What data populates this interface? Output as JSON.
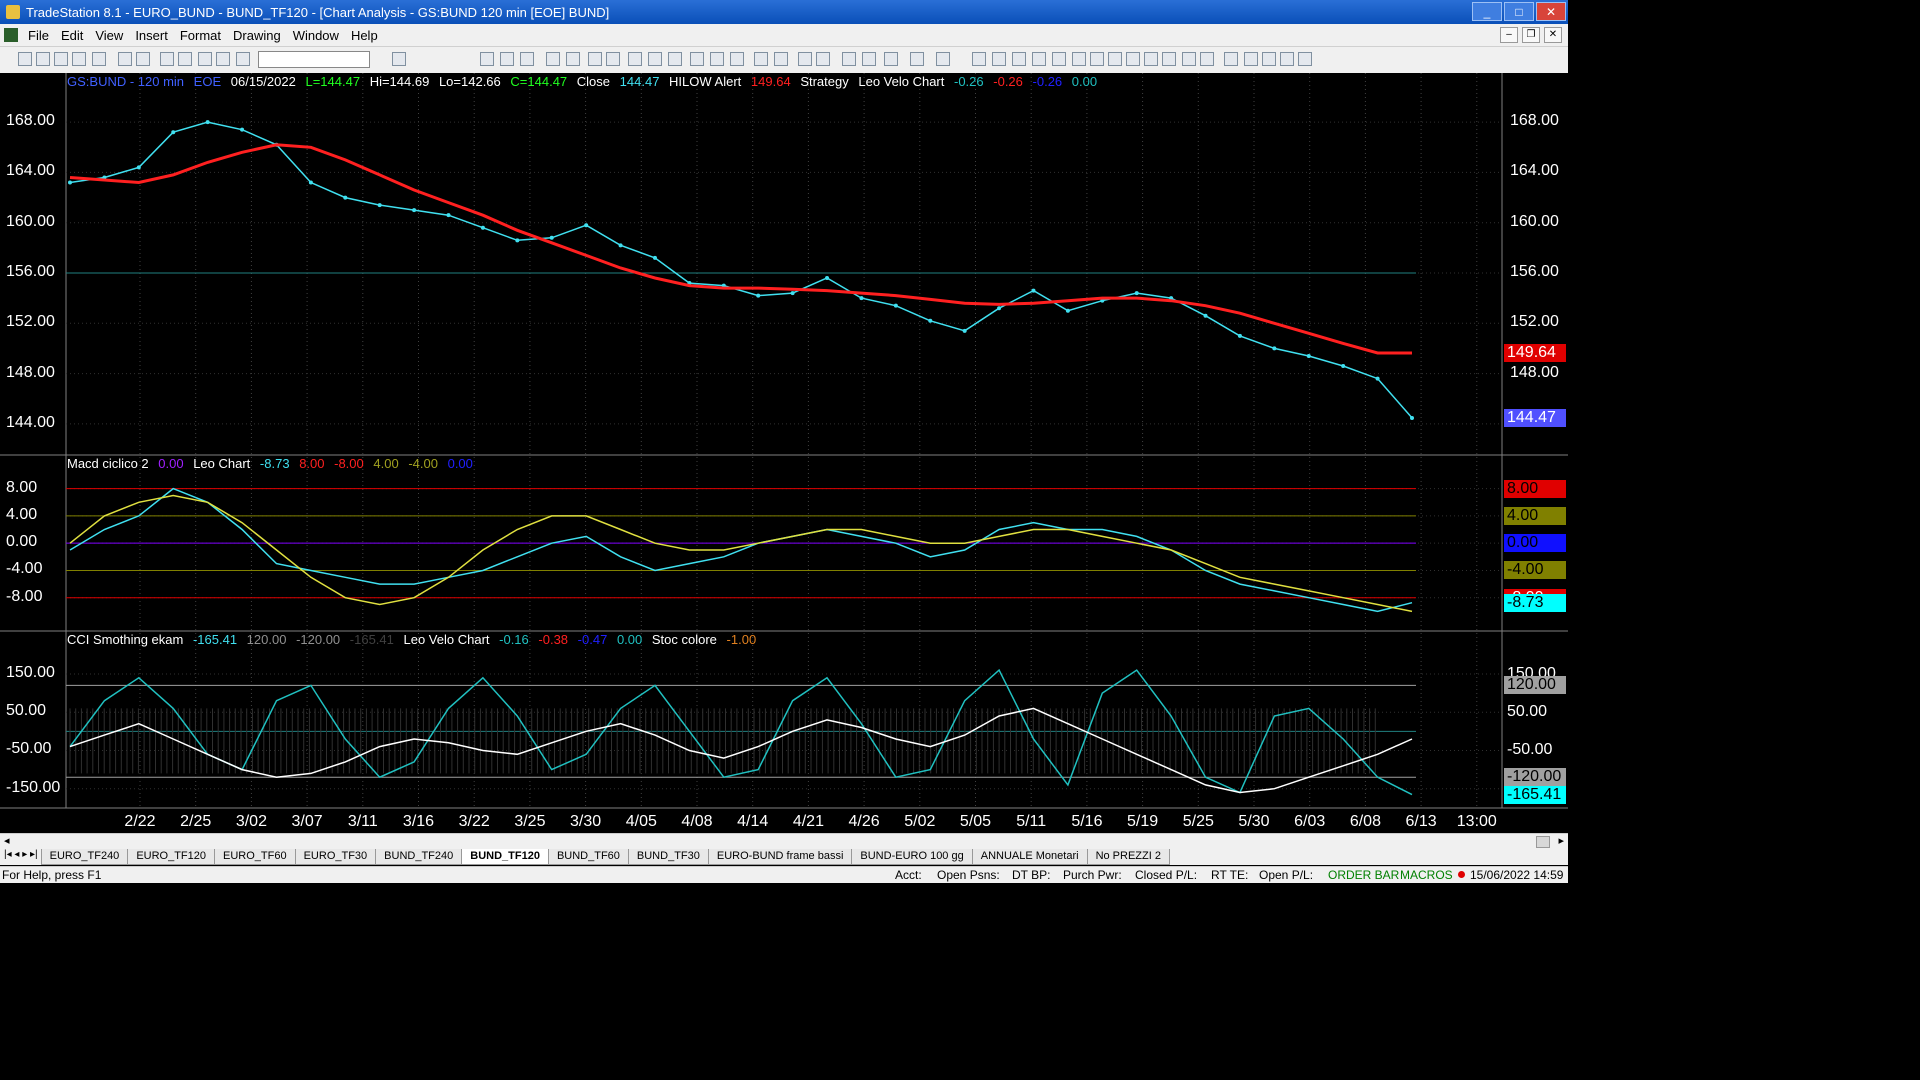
{
  "window": {
    "title": "TradeStation 8.1 - EURO_BUND - BUND_TF120 - [Chart Analysis - GS:BUND  120 min  [EOE] BUND]",
    "btn_min": "_",
    "btn_max": "□",
    "btn_close": "✕"
  },
  "menu": [
    "File",
    "Edit",
    "View",
    "Insert",
    "Format",
    "Drawing",
    "Window",
    "Help"
  ],
  "chart_data": [
    {
      "type": "line",
      "symbol": "GS:BUND - 120 min",
      "header": {
        "symbol": "GS:BUND - 120 min",
        "session": "EOE",
        "date": "06/15/2022",
        "last": "L=144.47",
        "high": "Hi=144.69",
        "low": "Lo=142.66",
        "close_eq": "C=144.47",
        "close_label": "Close",
        "close_val": "144.47",
        "hilow_label": "HILOW Alert",
        "hilow_val": "149.64",
        "strategy_label": "Strategy",
        "leo_label": "Leo Velo Chart",
        "leo_vals": [
          "-0.26",
          "-0.26",
          "-0.26",
          "0.00"
        ]
      },
      "ylim": [
        142,
        170
      ],
      "y_ticks": [
        "168.00",
        "164.00",
        "160.00",
        "156.00",
        "152.00",
        "148.00",
        "144.00"
      ],
      "right_labels": [
        {
          "text": "149.64",
          "bg": "#e00000",
          "fg": "#ffffff"
        },
        {
          "text": "144.47",
          "bg": "#5050ff",
          "fg": "#ffffff"
        }
      ],
      "series": [
        {
          "name": "Close",
          "color": "#40e0f0",
          "values": [
            163.2,
            163.6,
            164.4,
            167.2,
            168.0,
            167.4,
            166.2,
            163.2,
            162.0,
            161.4,
            161.0,
            160.6,
            159.6,
            158.6,
            158.8,
            159.8,
            158.2,
            157.2,
            155.2,
            155.0,
            154.2,
            154.4,
            155.6,
            154.0,
            153.4,
            152.2,
            151.4,
            153.2,
            154.6,
            153.0,
            153.8,
            154.4,
            154.0,
            152.6,
            151.0,
            150.0,
            149.4,
            148.6,
            147.6,
            144.47
          ]
        },
        {
          "name": "HILOW Alert",
          "color": "#ff2020",
          "values": [
            163.6,
            163.4,
            163.2,
            163.8,
            164.8,
            165.6,
            166.2,
            166.0,
            165.0,
            163.8,
            162.6,
            161.6,
            160.6,
            159.4,
            158.4,
            157.4,
            156.4,
            155.6,
            155.0,
            154.8,
            154.8,
            154.7,
            154.6,
            154.4,
            154.2,
            153.9,
            153.6,
            153.5,
            153.6,
            153.8,
            154.0,
            154.0,
            153.8,
            153.4,
            152.8,
            152.0,
            151.2,
            150.4,
            149.64,
            149.64
          ]
        }
      ]
    },
    {
      "type": "line",
      "header": {
        "name": "Macd ciclico 2",
        "v0": "0.00",
        "leo_label": "Leo Chart",
        "vals": [
          "-8.73",
          "8.00",
          "-8.00",
          "4.00",
          "-4.00",
          "0.00"
        ]
      },
      "ylim": [
        -12,
        10
      ],
      "y_ticks": [
        "8.00",
        "4.00",
        "0.00",
        "-4.00",
        "-8.00"
      ],
      "right_labels": [
        {
          "text": "8.00",
          "bg": "#e00000",
          "fg": "#000000"
        },
        {
          "text": "4.00",
          "bg": "#808000",
          "fg": "#000000"
        },
        {
          "text": "0.00",
          "bg": "#1010ff",
          "fg": "#000000"
        },
        {
          "text": "-4.00",
          "bg": "#808000",
          "fg": "#000000"
        },
        {
          "text": "-8.00",
          "bg": "#e00000",
          "fg": "#ffffff"
        },
        {
          "text": "-8.73",
          "bg": "#00ffff",
          "fg": "#000000"
        }
      ],
      "series": [
        {
          "name": "Leo Chart",
          "color": "#40e0f0",
          "values": [
            -1,
            2,
            4,
            8,
            6,
            2,
            -3,
            -4,
            -5,
            -6,
            -6,
            -5,
            -4,
            -2,
            0,
            1,
            -2,
            -4,
            -3,
            -2,
            0,
            1,
            2,
            1,
            0,
            -2,
            -1,
            2,
            3,
            2,
            2,
            1,
            -1,
            -4,
            -6,
            -7,
            -8,
            -9,
            -10,
            -8.73
          ]
        },
        {
          "name": "Macd ciclico 2",
          "color": "#e0e040",
          "values": [
            0,
            4,
            6,
            7,
            6,
            3,
            -1,
            -5,
            -8,
            -9,
            -8,
            -5,
            -1,
            2,
            4,
            4,
            2,
            0,
            -1,
            -1,
            0,
            1,
            2,
            2,
            1,
            0,
            0,
            1,
            2,
            2,
            1,
            0,
            -1,
            -3,
            -5,
            -6,
            -7,
            -8,
            -9,
            -10
          ]
        }
      ]
    },
    {
      "type": "line",
      "header": {
        "name": "CCI Smothing ekam",
        "vals": [
          "-165.41",
          "120.00",
          "-120.00",
          "-165.41"
        ],
        "leo_label": "Leo Velo Chart",
        "leo_vals": [
          "-0.16",
          "-0.38",
          "-0.47",
          "0.00"
        ],
        "stoc_label": "Stoc colore",
        "stoc_val": "-1.00"
      },
      "ylim": [
        -190,
        210
      ],
      "y_ticks": [
        "150.00",
        "50.00",
        "-50.00",
        "-150.00"
      ],
      "right_labels": [
        {
          "text": "150.00",
          "bg": "#000000",
          "fg": "#ffffff"
        },
        {
          "text": "120.00",
          "bg": "#a0a0a0",
          "fg": "#000000"
        },
        {
          "text": "50.00",
          "bg": "#000000",
          "fg": "#ffffff"
        },
        {
          "text": "-50.00",
          "bg": "#000000",
          "fg": "#ffffff"
        },
        {
          "text": "-120.00",
          "bg": "#a0a0a0",
          "fg": "#000000"
        },
        {
          "text": "-165.41",
          "bg": "#00ffff",
          "fg": "#000000"
        }
      ],
      "series": [
        {
          "name": "CCI Smothing ekam",
          "color": "#20c0c0",
          "values": [
            -40,
            80,
            140,
            60,
            -60,
            -100,
            80,
            120,
            -20,
            -120,
            -80,
            60,
            140,
            40,
            -100,
            -60,
            60,
            120,
            0,
            -120,
            -100,
            80,
            140,
            20,
            -120,
            -100,
            80,
            160,
            -20,
            -140,
            100,
            160,
            40,
            -120,
            -160,
            40,
            60,
            -20,
            -120,
            -165.41
          ]
        },
        {
          "name": "Leo Velo Chart",
          "color": "#ffffff",
          "values": [
            -40,
            -10,
            20,
            -20,
            -60,
            -100,
            -120,
            -110,
            -80,
            -40,
            -20,
            -30,
            -50,
            -60,
            -30,
            0,
            20,
            -10,
            -50,
            -70,
            -40,
            0,
            30,
            10,
            -20,
            -40,
            -10,
            40,
            60,
            20,
            -20,
            -60,
            -100,
            -140,
            -160,
            -150,
            -120,
            -90,
            -60,
            -20
          ]
        }
      ]
    }
  ],
  "x_labels": [
    "2/22",
    "2/25",
    "3/02",
    "3/07",
    "3/11",
    "3/16",
    "3/22",
    "3/25",
    "3/30",
    "4/05",
    "4/08",
    "4/14",
    "4/21",
    "4/26",
    "5/02",
    "5/05",
    "5/11",
    "5/16",
    "5/19",
    "5/25",
    "5/30",
    "6/03",
    "6/08",
    "6/13",
    "13:00"
  ],
  "tabs": [
    "EURO_TF240",
    "EURO_TF120",
    "EURO_TF60",
    "EURO_TF30",
    "BUND_TF240",
    "BUND_TF120",
    "BUND_TF60",
    "BUND_TF30",
    "EURO-BUND frame bassi",
    "BUND-EURO 100 gg",
    "ANNUALE Monetari",
    "No PREZZI 2"
  ],
  "active_tab": "BUND_TF120",
  "status": {
    "help": "For Help, press F1",
    "acct": "Acct:",
    "open_psns": "Open Psns:",
    "dt_bp": "DT BP:",
    "purch_pwr": "Purch Pwr:",
    "closed_pl": "Closed P/L:",
    "rt_te": "RT TE:",
    "open_pl": "Open P/L:",
    "order_bar": "ORDER BAR",
    "macros": "MACROS",
    "datetime": "15/06/2022 14:59"
  }
}
